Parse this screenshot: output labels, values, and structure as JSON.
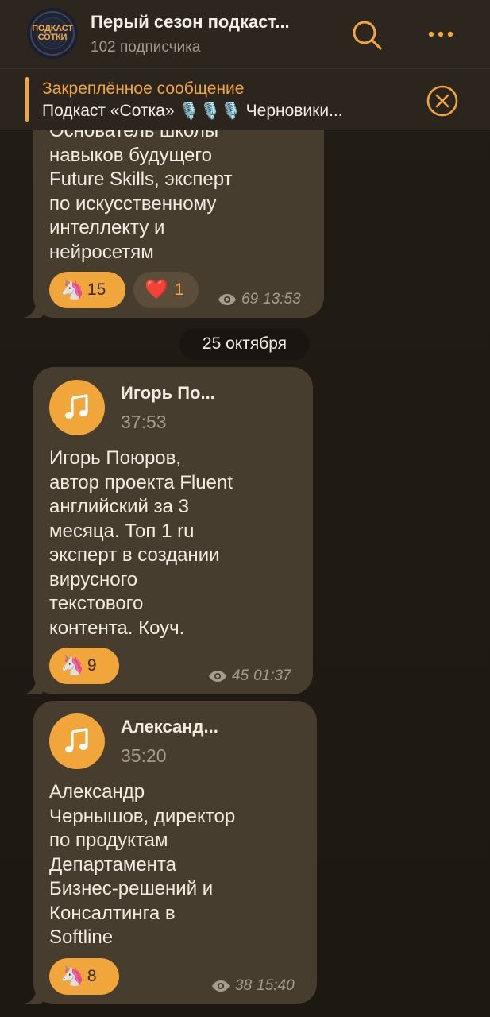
{
  "channel": {
    "title": "Перый сезон подкаст...",
    "subscribers": "102 подписчика",
    "avatar_text_line1": "ПОДКАСТ",
    "avatar_text_line2": "СОТКИ"
  },
  "pinned": {
    "label": "Закреплённое сообщение",
    "text": "Подкаст «Сотка» 🎙️🎙️🎙️ Черновики..."
  },
  "messages": [
    {
      "text_lines": [
        "Основатель школы",
        "навыков будущего",
        "Future Skills, эксперт",
        "по искусственному",
        "интеллекту и",
        "нейросетям"
      ],
      "reactions": [
        {
          "emoji": "🦄",
          "count": "15",
          "active": true
        },
        {
          "emoji": "❤️",
          "count": "1",
          "active": false
        }
      ],
      "views": "69",
      "time": "13:53"
    },
    {
      "audio_title": "Игорь По...",
      "duration": "37:53",
      "text_lines": [
        "Игорь Поюров,",
        "автор проекта Fluent",
        "английский за 3",
        "месяца. Топ 1 ru",
        "эксперт в создании",
        "вирусного",
        "текстового",
        "контента. Коуч."
      ],
      "reactions": [
        {
          "emoji": "🦄",
          "count": "9",
          "active": true
        }
      ],
      "views": "45",
      "time": "01:37"
    },
    {
      "audio_title": "Александ...",
      "duration": "35:20",
      "text_lines": [
        "Александр",
        "Чернышов, директор",
        "по продуктам",
        "Департамента",
        "Бизнес-решений и",
        "Консалтинга в",
        "Softline"
      ],
      "reactions": [
        {
          "emoji": "🦄",
          "count": "8",
          "active": true
        }
      ],
      "views": "38",
      "time": "15:40"
    }
  ],
  "date_separator": "25 октября",
  "colors": {
    "accent": "#f0a63a",
    "bubble": "#473d2f",
    "background": "#1f1a14"
  }
}
